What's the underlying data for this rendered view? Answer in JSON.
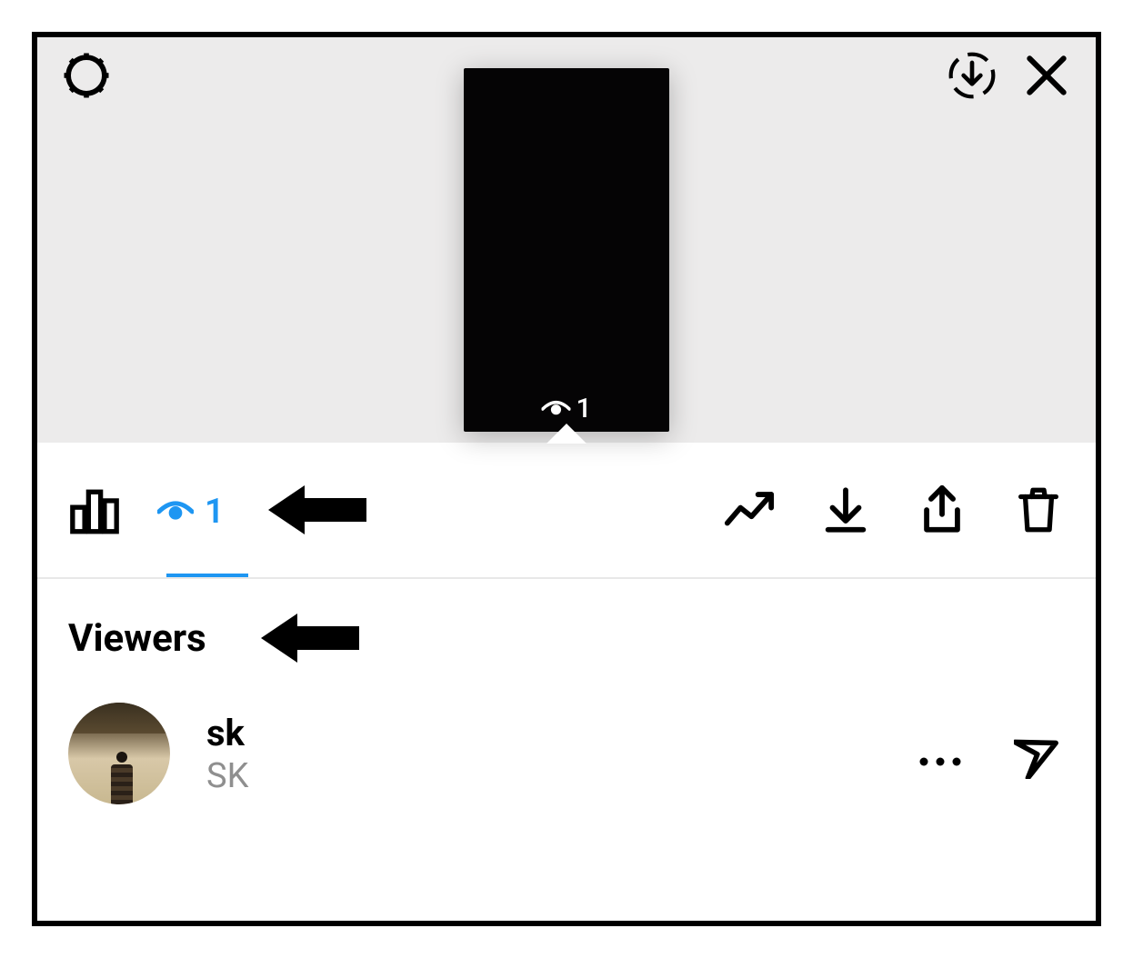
{
  "colors": {
    "accent": "#1e96f2"
  },
  "preview": {
    "viewCount": "1"
  },
  "tabs": {
    "viewers_count": "1"
  },
  "section": {
    "heading": "Viewers"
  },
  "viewers": [
    {
      "username": "sk",
      "fullname": "SK"
    }
  ],
  "icons": {
    "gear": "gear-icon",
    "download_circle": "download-circle-icon",
    "close": "close-icon",
    "insights": "bar-chart-icon",
    "eye": "eye-icon",
    "trend": "trending-up-icon",
    "download": "download-icon",
    "share": "share-icon",
    "trash": "trash-icon",
    "more": "more-icon",
    "send": "send-icon"
  }
}
